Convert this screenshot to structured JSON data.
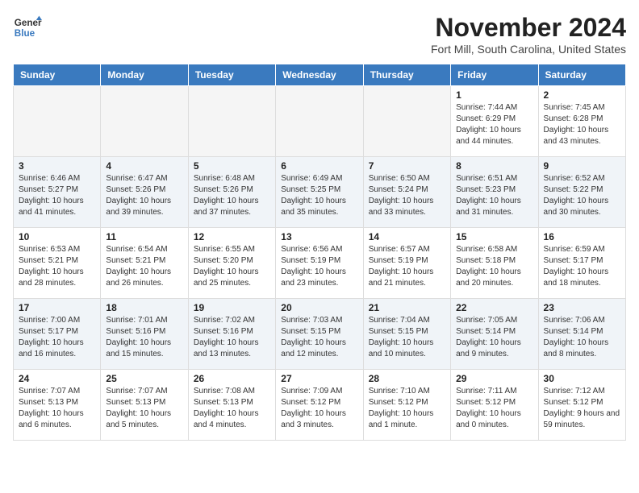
{
  "logo": {
    "line1": "General",
    "line2": "Blue"
  },
  "header": {
    "month": "November 2024",
    "location": "Fort Mill, South Carolina, United States"
  },
  "weekdays": [
    "Sunday",
    "Monday",
    "Tuesday",
    "Wednesday",
    "Thursday",
    "Friday",
    "Saturday"
  ],
  "weeks": [
    [
      {
        "day": "",
        "empty": true
      },
      {
        "day": "",
        "empty": true
      },
      {
        "day": "",
        "empty": true
      },
      {
        "day": "",
        "empty": true
      },
      {
        "day": "",
        "empty": true
      },
      {
        "day": "1",
        "sunrise": "Sunrise: 7:44 AM",
        "sunset": "Sunset: 6:29 PM",
        "daylight": "Daylight: 10 hours and 44 minutes."
      },
      {
        "day": "2",
        "sunrise": "Sunrise: 7:45 AM",
        "sunset": "Sunset: 6:28 PM",
        "daylight": "Daylight: 10 hours and 43 minutes."
      }
    ],
    [
      {
        "day": "3",
        "sunrise": "Sunrise: 6:46 AM",
        "sunset": "Sunset: 5:27 PM",
        "daylight": "Daylight: 10 hours and 41 minutes."
      },
      {
        "day": "4",
        "sunrise": "Sunrise: 6:47 AM",
        "sunset": "Sunset: 5:26 PM",
        "daylight": "Daylight: 10 hours and 39 minutes."
      },
      {
        "day": "5",
        "sunrise": "Sunrise: 6:48 AM",
        "sunset": "Sunset: 5:26 PM",
        "daylight": "Daylight: 10 hours and 37 minutes."
      },
      {
        "day": "6",
        "sunrise": "Sunrise: 6:49 AM",
        "sunset": "Sunset: 5:25 PM",
        "daylight": "Daylight: 10 hours and 35 minutes."
      },
      {
        "day": "7",
        "sunrise": "Sunrise: 6:50 AM",
        "sunset": "Sunset: 5:24 PM",
        "daylight": "Daylight: 10 hours and 33 minutes."
      },
      {
        "day": "8",
        "sunrise": "Sunrise: 6:51 AM",
        "sunset": "Sunset: 5:23 PM",
        "daylight": "Daylight: 10 hours and 31 minutes."
      },
      {
        "day": "9",
        "sunrise": "Sunrise: 6:52 AM",
        "sunset": "Sunset: 5:22 PM",
        "daylight": "Daylight: 10 hours and 30 minutes."
      }
    ],
    [
      {
        "day": "10",
        "sunrise": "Sunrise: 6:53 AM",
        "sunset": "Sunset: 5:21 PM",
        "daylight": "Daylight: 10 hours and 28 minutes."
      },
      {
        "day": "11",
        "sunrise": "Sunrise: 6:54 AM",
        "sunset": "Sunset: 5:21 PM",
        "daylight": "Daylight: 10 hours and 26 minutes."
      },
      {
        "day": "12",
        "sunrise": "Sunrise: 6:55 AM",
        "sunset": "Sunset: 5:20 PM",
        "daylight": "Daylight: 10 hours and 25 minutes."
      },
      {
        "day": "13",
        "sunrise": "Sunrise: 6:56 AM",
        "sunset": "Sunset: 5:19 PM",
        "daylight": "Daylight: 10 hours and 23 minutes."
      },
      {
        "day": "14",
        "sunrise": "Sunrise: 6:57 AM",
        "sunset": "Sunset: 5:19 PM",
        "daylight": "Daylight: 10 hours and 21 minutes."
      },
      {
        "day": "15",
        "sunrise": "Sunrise: 6:58 AM",
        "sunset": "Sunset: 5:18 PM",
        "daylight": "Daylight: 10 hours and 20 minutes."
      },
      {
        "day": "16",
        "sunrise": "Sunrise: 6:59 AM",
        "sunset": "Sunset: 5:17 PM",
        "daylight": "Daylight: 10 hours and 18 minutes."
      }
    ],
    [
      {
        "day": "17",
        "sunrise": "Sunrise: 7:00 AM",
        "sunset": "Sunset: 5:17 PM",
        "daylight": "Daylight: 10 hours and 16 minutes."
      },
      {
        "day": "18",
        "sunrise": "Sunrise: 7:01 AM",
        "sunset": "Sunset: 5:16 PM",
        "daylight": "Daylight: 10 hours and 15 minutes."
      },
      {
        "day": "19",
        "sunrise": "Sunrise: 7:02 AM",
        "sunset": "Sunset: 5:16 PM",
        "daylight": "Daylight: 10 hours and 13 minutes."
      },
      {
        "day": "20",
        "sunrise": "Sunrise: 7:03 AM",
        "sunset": "Sunset: 5:15 PM",
        "daylight": "Daylight: 10 hours and 12 minutes."
      },
      {
        "day": "21",
        "sunrise": "Sunrise: 7:04 AM",
        "sunset": "Sunset: 5:15 PM",
        "daylight": "Daylight: 10 hours and 10 minutes."
      },
      {
        "day": "22",
        "sunrise": "Sunrise: 7:05 AM",
        "sunset": "Sunset: 5:14 PM",
        "daylight": "Daylight: 10 hours and 9 minutes."
      },
      {
        "day": "23",
        "sunrise": "Sunrise: 7:06 AM",
        "sunset": "Sunset: 5:14 PM",
        "daylight": "Daylight: 10 hours and 8 minutes."
      }
    ],
    [
      {
        "day": "24",
        "sunrise": "Sunrise: 7:07 AM",
        "sunset": "Sunset: 5:13 PM",
        "daylight": "Daylight: 10 hours and 6 minutes."
      },
      {
        "day": "25",
        "sunrise": "Sunrise: 7:07 AM",
        "sunset": "Sunset: 5:13 PM",
        "daylight": "Daylight: 10 hours and 5 minutes."
      },
      {
        "day": "26",
        "sunrise": "Sunrise: 7:08 AM",
        "sunset": "Sunset: 5:13 PM",
        "daylight": "Daylight: 10 hours and 4 minutes."
      },
      {
        "day": "27",
        "sunrise": "Sunrise: 7:09 AM",
        "sunset": "Sunset: 5:12 PM",
        "daylight": "Daylight: 10 hours and 3 minutes."
      },
      {
        "day": "28",
        "sunrise": "Sunrise: 7:10 AM",
        "sunset": "Sunset: 5:12 PM",
        "daylight": "Daylight: 10 hours and 1 minute."
      },
      {
        "day": "29",
        "sunrise": "Sunrise: 7:11 AM",
        "sunset": "Sunset: 5:12 PM",
        "daylight": "Daylight: 10 hours and 0 minutes."
      },
      {
        "day": "30",
        "sunrise": "Sunrise: 7:12 AM",
        "sunset": "Sunset: 5:12 PM",
        "daylight": "Daylight: 9 hours and 59 minutes."
      }
    ]
  ]
}
